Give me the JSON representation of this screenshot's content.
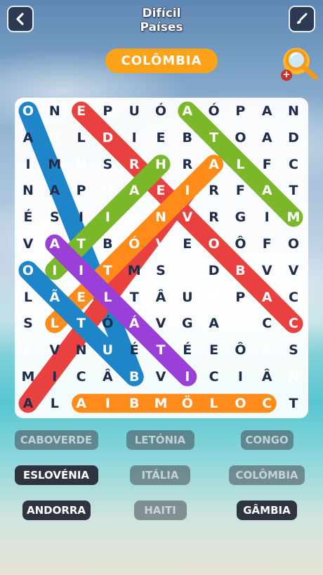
{
  "header": {
    "back_icon": "chevron-left-icon",
    "title_line1": "Difícil",
    "title_line2": "Países",
    "brush_icon": "brush-icon"
  },
  "current_word": "COLÔMBIA",
  "hint": {
    "icon": "magnifier-icon",
    "badge": "+"
  },
  "grid": [
    [
      "O",
      "N",
      "E",
      "P",
      "U",
      "Ó",
      "A",
      "Ó",
      "P",
      "A",
      "N"
    ],
    [
      "A",
      "G",
      "L",
      "D",
      "I",
      "E",
      "B",
      "T",
      "O",
      "A",
      "D"
    ],
    [
      "I",
      "M",
      "N",
      "S",
      "R",
      "H",
      "R",
      "A",
      "L",
      "F",
      "C"
    ],
    [
      "N",
      "A",
      "P",
      "O",
      "A",
      "E",
      "I",
      "R",
      "F",
      "A",
      "T"
    ],
    [
      "É",
      "S",
      "I",
      "I",
      "C",
      "N",
      "V",
      "R",
      "G",
      "I",
      "M"
    ],
    [
      "V",
      "A",
      "T",
      "B",
      "Ó",
      "V",
      "E",
      "O",
      "Ô",
      "F",
      "O"
    ],
    [
      "O",
      "I",
      "I",
      "T",
      "M",
      "S",
      "U",
      "D",
      "B",
      "V",
      "V"
    ],
    [
      "L",
      "Ã",
      "E",
      "L",
      "T",
      "Â",
      "U",
      "N",
      "P",
      "A",
      "C"
    ],
    [
      "S",
      "L",
      "T",
      "Ó",
      "Á",
      "V",
      "G",
      "A",
      "Â",
      "C",
      "C"
    ],
    [
      "E",
      "V",
      "N",
      "U",
      "É",
      "T",
      "É",
      "E",
      "Ô",
      "R",
      "S"
    ],
    [
      "M",
      "I",
      "C",
      "Â",
      "B",
      "V",
      "I",
      "C",
      "I",
      "Â",
      "N"
    ],
    [
      "A",
      "L",
      "A",
      "I",
      "B",
      "M",
      "Ö",
      "L",
      "O",
      "C",
      "T"
    ]
  ],
  "highlights": [
    {
      "word": "CABOVERDE",
      "color": "#1e86c8",
      "from": [
        0,
        0
      ],
      "to": [
        10,
        4
      ]
    },
    {
      "word": "ESLOVÉNIA",
      "color": "#e8413f",
      "from": [
        0,
        2
      ],
      "to": [
        8,
        10
      ]
    },
    {
      "word": "ESLOVÉNIA_2",
      "color": "#e8413f",
      "from": [
        3,
        6
      ],
      "to": [
        11,
        0
      ]
    },
    {
      "word": "LETÓNIA",
      "color": "#ff8c1a",
      "from": [
        2,
        7
      ],
      "to": [
        8,
        1
      ]
    },
    {
      "word": "ITÁLIA",
      "color": "#7ab82a",
      "from": [
        2,
        5
      ],
      "to": [
        6,
        1
      ]
    },
    {
      "word": "CONGO",
      "color": "#7ab82a",
      "from": [
        0,
        6
      ],
      "to": [
        4,
        10
      ]
    },
    {
      "word": "HAITI",
      "color": "#1e86c8",
      "from": [
        6,
        0
      ],
      "to": [
        10,
        4
      ]
    },
    {
      "word": "GÂMBIA",
      "color": "#9b3fd9",
      "from": [
        5,
        1
      ],
      "to": [
        10,
        6
      ]
    },
    {
      "word": "COLÔMBIA",
      "color": "#ff8c1a",
      "from": [
        11,
        2
      ],
      "to": [
        11,
        9
      ]
    }
  ],
  "words": [
    {
      "label": "CABOVERDE",
      "found": true
    },
    {
      "label": "LETÓNIA",
      "found": true
    },
    {
      "label": "CONGO",
      "found": true
    },
    {
      "label": "ESLOVÉNIA",
      "found": false
    },
    {
      "label": "ITÁLIA",
      "found": true
    },
    {
      "label": "COLÔMBIA",
      "found": true
    },
    {
      "label": "ANDORRA",
      "found": false
    },
    {
      "label": "HAITI",
      "found": true
    },
    {
      "label": "GÂMBIA",
      "found": false
    }
  ]
}
